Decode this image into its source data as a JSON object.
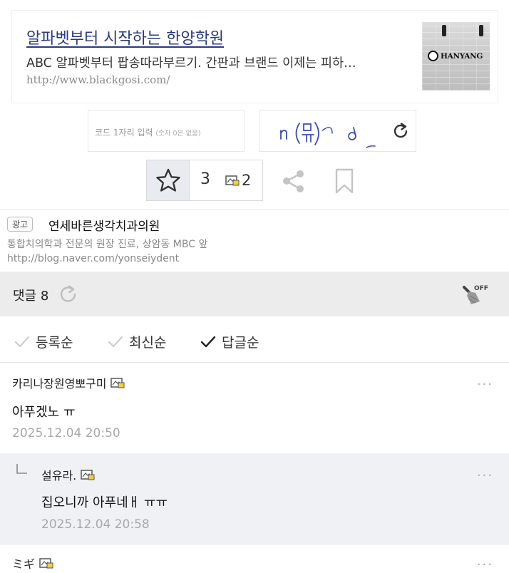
{
  "ad_card": {
    "title": "알파벳부터 시작하는 한양학원",
    "description": "ABC 알파벳부터 팝송따라부르기. 간판과 브랜드 이제는 피하…",
    "url": "http://www.blackgosi.com/",
    "thumb_logo_text": "HANYANG"
  },
  "captcha": {
    "placeholder": "코드 1자리 입력",
    "placeholder_note": "(숫자 0은 없음)",
    "scribble_text": "n (뮤) d"
  },
  "actions": {
    "like_count": "3",
    "comment_count": "2"
  },
  "ad2": {
    "badge": "광고",
    "title": "연세바른생각치과의원",
    "description": "통합치의학과 전문의 원장 진료, 상암동 MBC 앞",
    "url": "http://blog.naver.com/yonseiydent"
  },
  "comments_bar": {
    "label": "댓글 8",
    "clean_badge": "OFF"
  },
  "sort_options": [
    {
      "label": "등록순",
      "active": false
    },
    {
      "label": "최신순",
      "active": false
    },
    {
      "label": "답글순",
      "active": true
    }
  ],
  "comments": [
    {
      "nick": "카리나장원영뽀구미",
      "body": "아푸겠노 ㅠ",
      "date": "2025.12.04 20:50",
      "more": "···"
    },
    {
      "nick": "설유라.",
      "body": "집오니까 아푸네ㅐ ㅠㅠ",
      "date": "2025.12.04 20:58",
      "more": "···"
    },
    {
      "nick": "ミギ",
      "more": "···"
    }
  ],
  "colors": {
    "ad_title": "#2b3a7e",
    "comment_bar_bg": "#ececec",
    "reply_bg": "#eff1f5",
    "date_gray": "#a8a8a8",
    "star_btn_bg": "#e8ebf0"
  }
}
